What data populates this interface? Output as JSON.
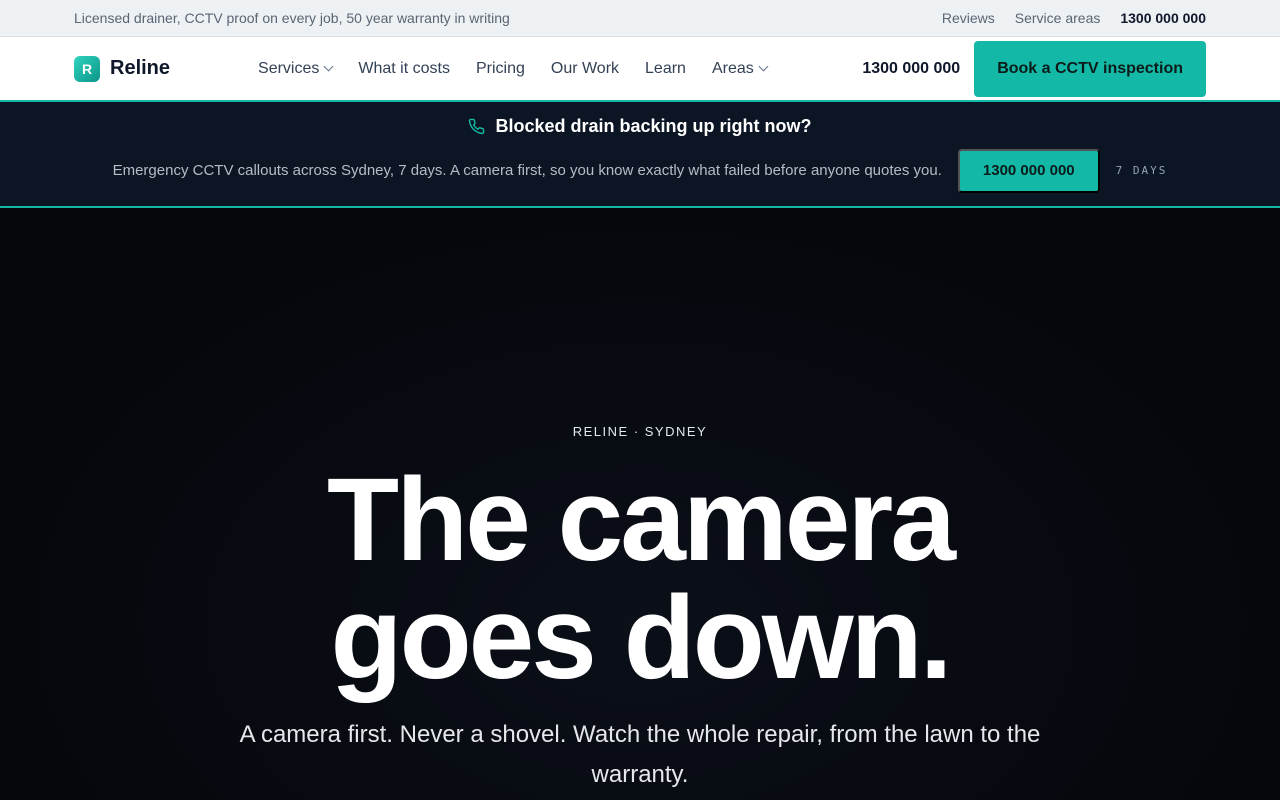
{
  "topbar": {
    "tagline": "Licensed drainer, CCTV proof on every job, 50 year warranty in writing",
    "links": [
      "Reviews",
      "Service areas"
    ],
    "phone": "1300 000 000"
  },
  "header": {
    "logo_letter": "R",
    "brand": "Reline",
    "nav": [
      {
        "label": "Services",
        "dropdown": true
      },
      {
        "label": "What it costs",
        "dropdown": false
      },
      {
        "label": "Pricing",
        "dropdown": false
      },
      {
        "label": "Our Work",
        "dropdown": false
      },
      {
        "label": "Learn",
        "dropdown": false
      },
      {
        "label": "Areas",
        "dropdown": true
      }
    ],
    "phone": "1300 000 000",
    "cta_label": "Book a CCTV inspection"
  },
  "emergency": {
    "icon": "phone-icon",
    "title": "Blocked drain backing up right now?",
    "text": "Emergency CCTV callouts across Sydney, 7 days. A camera first, so you know exactly what failed before anyone quotes you.",
    "phone_button": "1300 000 000",
    "days_label": "7 DAYS"
  },
  "hero": {
    "eyebrow": "RELINE · SYDNEY",
    "headline_line1": "The camera",
    "headline_line2": "goes down.",
    "subtitle": "A camera first. Never a shovel. Watch the whole repair, from the lawn to the warranty."
  },
  "colors": {
    "accent": "#14b8a6",
    "band_bg": "#0c1524",
    "hero_bg": "#05070c"
  }
}
